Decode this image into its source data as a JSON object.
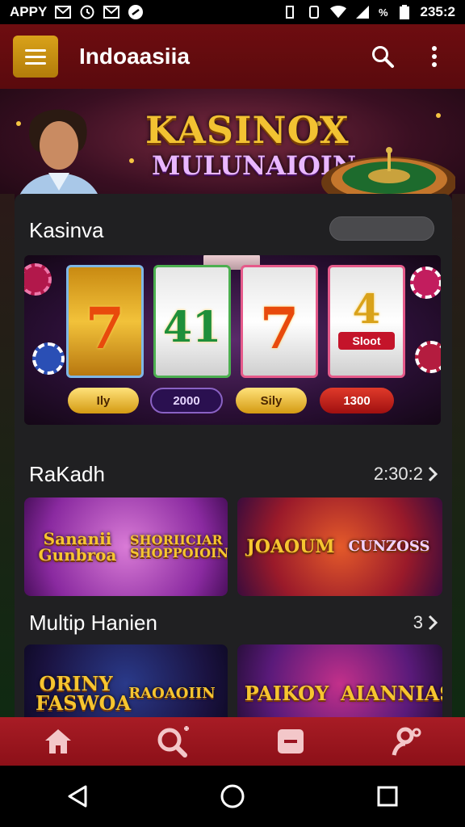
{
  "status_bar": {
    "carrier": "APPY",
    "battery": "%",
    "time": "235:2"
  },
  "app_bar": {
    "title": "Indoaasiia",
    "menu_icon": "hamburger-icon",
    "search_icon": "search-icon",
    "more_icon": "more-vert-icon"
  },
  "hero": {
    "title_line1": "KASINOX",
    "title_line2": "MULUNAIOIN"
  },
  "section_kasinva": {
    "title": "Kasinva",
    "slot": {
      "reels": [
        "7",
        "41",
        "7",
        "4"
      ],
      "reel4_caption": "Sloot",
      "buttons": [
        "Ily",
        "2000",
        "Sily",
        "1300"
      ]
    }
  },
  "section_rakadh": {
    "title": "RaKadh",
    "link_text": "2:30:2",
    "cards": [
      {
        "label": "Sananii Gunbroa"
      },
      {
        "label": "SHORIICIAR SHOPPOIOIN"
      },
      {
        "label": "JOAOUM"
      },
      {
        "label": "CUNZOSS"
      }
    ]
  },
  "section_multip": {
    "title": "Multip Hanien",
    "link_text": "3",
    "cards": [
      {
        "label": "ORINY FASWOA"
      },
      {
        "label": "RAOAOIIN"
      },
      {
        "label": "PAIKOY"
      },
      {
        "label": "AIANNIAS"
      }
    ]
  },
  "bottom_nav": {
    "items": [
      "home-icon",
      "search-icon",
      "wallet-icon",
      "profile-icon"
    ]
  },
  "colors": {
    "brand": "#6e0d10",
    "accent": "#d9a21a",
    "nav": "#a81c25"
  }
}
